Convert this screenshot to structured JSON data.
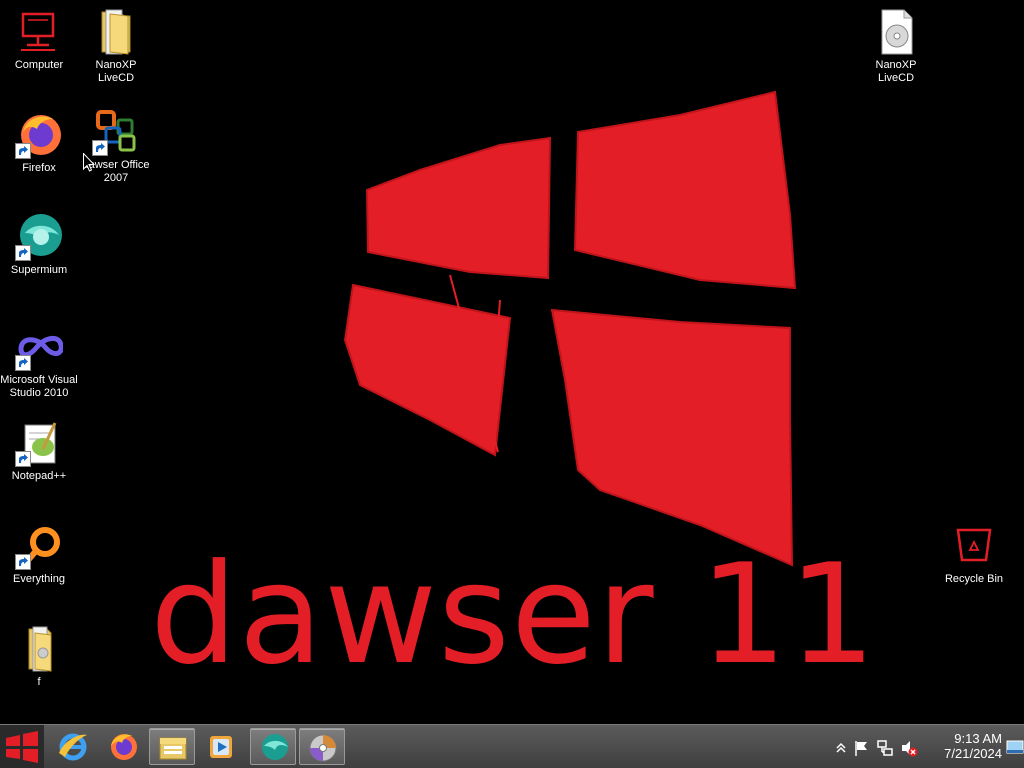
{
  "wallpaper": {
    "text": "dawser 11",
    "accent": "#e41e26"
  },
  "desktop_icons": [
    {
      "label": "Computer",
      "icon": "computer-icon"
    },
    {
      "label": "NanoXP LiveCD",
      "icon": "folder-icon"
    },
    {
      "label": "NanoXP LiveCD",
      "icon": "disc-file-icon"
    },
    {
      "label": "Firefox",
      "icon": "firefox-icon",
      "shortcut": true
    },
    {
      "label": "dawser Office 2007",
      "icon": "office-icon",
      "shortcut": true
    },
    {
      "label": "Supermium",
      "icon": "supermium-icon",
      "shortcut": true
    },
    {
      "label": "Microsoft Visual Studio 2010",
      "icon": "visual-studio-icon",
      "shortcut": true
    },
    {
      "label": "Notepad++",
      "icon": "notepadpp-icon",
      "shortcut": true
    },
    {
      "label": "Everything",
      "icon": "everything-icon",
      "shortcut": true
    },
    {
      "label": "f",
      "icon": "folder-icon"
    },
    {
      "label": "Recycle Bin",
      "icon": "recycle-bin-icon"
    }
  ],
  "taskbar": {
    "pinned": [
      "internet-explorer-icon",
      "firefox-icon",
      "file-explorer-icon",
      "media-player-icon",
      "supermium-icon",
      "disc-burner-icon"
    ],
    "tray": {
      "time": "9:13 AM",
      "date": "7/21/2024",
      "icons": [
        "show-hidden-icons-chevron",
        "action-center-flag-icon",
        "network-icon",
        "volume-muted-icon"
      ]
    }
  }
}
